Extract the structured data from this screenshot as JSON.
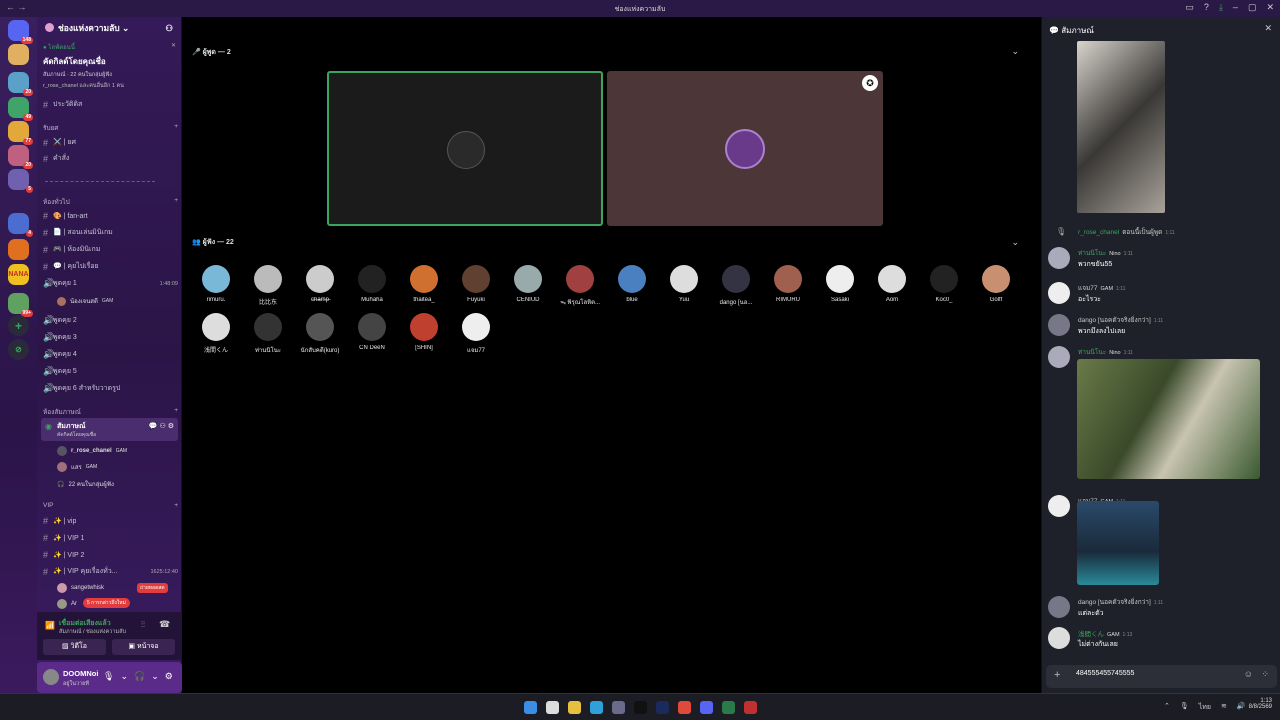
{
  "window": {
    "title": "ช่องแห่งความลับ"
  },
  "colors": {
    "accent": "#5865f2",
    "brand": "#5a2b88",
    "green": "#3ba55d",
    "red": "#e23c3c"
  },
  "rail": {
    "servers": [
      {
        "label": "",
        "badge": "148",
        "color": "#5865f2"
      },
      {
        "label": "",
        "badge": "",
        "color": "#e0b060"
      },
      {
        "label": "",
        "badge": "20",
        "color": "#5aa0c8"
      },
      {
        "label": "",
        "badge": "49",
        "color": "#3fa36a"
      },
      {
        "label": "",
        "badge": "77",
        "color": "#e2a93a"
      },
      {
        "label": "",
        "badge": "20",
        "color": "#c06080"
      },
      {
        "label": "",
        "badge": "5",
        "color": "#7060b0"
      },
      {
        "label": "",
        "badge": "4",
        "color": "#4b6cd0"
      },
      {
        "label": "",
        "badge": "",
        "color": "#e07020"
      },
      {
        "label": "NANA",
        "badge": "",
        "color": "#f0c020"
      },
      {
        "label": "",
        "badge": "99+",
        "color": "#60a060"
      }
    ]
  },
  "channels": {
    "server_name": "ช่องแห่งความลับ",
    "event": {
      "status": "ไลฟ์ตอนนี้",
      "title": "คัดกิลด์โดยคุณชื่อ",
      "line1": "สัมภาษณ์ · 22 คนในกลุ่มผู้ฟัง",
      "line2": "r_rose_chanel และคนอื่นอีก 1 คน"
    },
    "top": [
      {
        "label": "ประวัติดิส"
      }
    ],
    "cat1": "รับยศ",
    "cat1_items": [
      {
        "label": "⚔️ | ยศ"
      },
      {
        "label": "คำสั่ง"
      }
    ],
    "cat2": "ห้องทั่วไป",
    "cat2_items": [
      {
        "label": "🎨 | fan-art"
      },
      {
        "label": "📄 | สอนเล่นมินิเกม"
      },
      {
        "label": "🎮 | ห้องมินิเกม"
      },
      {
        "label": "💬 | คุยไปเรื่อย"
      }
    ],
    "voice": [
      {
        "label": "พูดคุย 1",
        "time": "1:48:09"
      },
      {
        "label": "พูดคุย 2"
      },
      {
        "label": "พูดคุย 3"
      },
      {
        "label": "พูดคุย 4"
      },
      {
        "label": "พูดคุย 5"
      },
      {
        "label": "พูดคุย 6 สำหรับวาดรูป"
      }
    ],
    "voice1_user": {
      "name": "น้องเจนสดี",
      "tag": "GAM"
    },
    "cat3": "ห้องสัมภาษณ์",
    "stage": {
      "name": "สัมภาษณ์",
      "desc": "คัดกิลด์โดยคุณชื่อ",
      "u1": "r_rose_chanel",
      "u1tag": "GAM",
      "u2": "แสร",
      "u2tag": "GAM",
      "listeners": "22 คนในกลุ่มผู้ฟัง"
    },
    "cat4": "VIP",
    "vip": [
      {
        "label": "✨ | vip"
      },
      {
        "label": "✨ | VIP 1"
      },
      {
        "label": "✨ | VIP 2"
      },
      {
        "label": "✨ | VIP คุยเรื่องทั่ว...",
        "time": "1625:12:40"
      }
    ],
    "vip_u1": "sangetwhisk",
    "vip_u1_badge": "ถ่ายทอดสด",
    "vip_u2": "Ar",
    "mention_pill": "5 การกล่าวถึงใหม่"
  },
  "voicebar": {
    "status": "เชื่อมต่อเสียงแล้ว",
    "where": "สัมภาษณ์ / ช่องแห่งความลับ",
    "video": "วิดีโอ",
    "screen": "หน้าจอ"
  },
  "userbar": {
    "name": "DOOMNoi",
    "status": "อยู่ในวายที"
  },
  "stage": {
    "speakers_label": "ผู้พูด — 2",
    "audience_label": "ผู้ฟัง — 22",
    "audience": [
      "rimuru.",
      "比比东",
      "c̶h̶a̶m̶p̶",
      "Muhaha",
      "thaitea_",
      "Fuyuki",
      "CENIUD",
      "ᯓ พิรุณโลหิต...",
      "blue",
      "Yuu",
      "dango [นอ...",
      "RIMURU",
      "Sasaki",
      "Aom",
      "Koc0_",
      "Golff",
      "浅間くん",
      "ท่านนิโนะ",
      "นักสับคดี(kuro)",
      "CN DeeN",
      "[SHIN]",
      "แจม77"
    ],
    "audience_colors": [
      "#7ab8d8",
      "#bbb",
      "#ccc",
      "#222",
      "#d07030",
      "#604030",
      "#9aa",
      "#a04040",
      "#4a80c0",
      "#ddd",
      "#334",
      "#a06050",
      "#eee",
      "#ddd",
      "#222",
      "#c89070",
      "#ddd",
      "#333",
      "#555",
      "#444",
      "#c04030",
      "#eee"
    ]
  },
  "chat": {
    "title": "สัมภาษณ์",
    "messages": [
      {
        "name": "r_rose_chanel",
        "text": "ตอนนี้เป็นผู้พูด",
        "time": "1:11"
      },
      {
        "name": "ท่านนิโนะ",
        "tag": "Nino",
        "time": "1:11",
        "text": "พวกขยัน55"
      },
      {
        "name": "แจม77",
        "tag": "GAM",
        "time": "1:11",
        "text": "อะไรวะ"
      },
      {
        "name": "dango [นอคตัวจริงยิ่งกว่า]",
        "tag": "",
        "time": "1:11",
        "text": "พวกมึงลงไปเลย"
      },
      {
        "name": "ท่านนิโนะ",
        "tag": "Nino",
        "time": "1:11",
        "text": ""
      },
      {
        "name": "แจม77",
        "tag": "GAM",
        "time": "1:11",
        "text": ""
      },
      {
        "name": "dango [นอคตัวจริงยิ่งกว่า]",
        "tag": "",
        "time": "1:11",
        "text": "แต่ละตัว"
      },
      {
        "name": "浅間くん",
        "tag": "GAM",
        "time": "1:13",
        "text": "ไม่ต่างกันเลย"
      }
    ],
    "input_value": "484555455745555"
  },
  "taskbar": {
    "time": "1:13",
    "date": "8/8/2569",
    "lang": "ไทย"
  }
}
